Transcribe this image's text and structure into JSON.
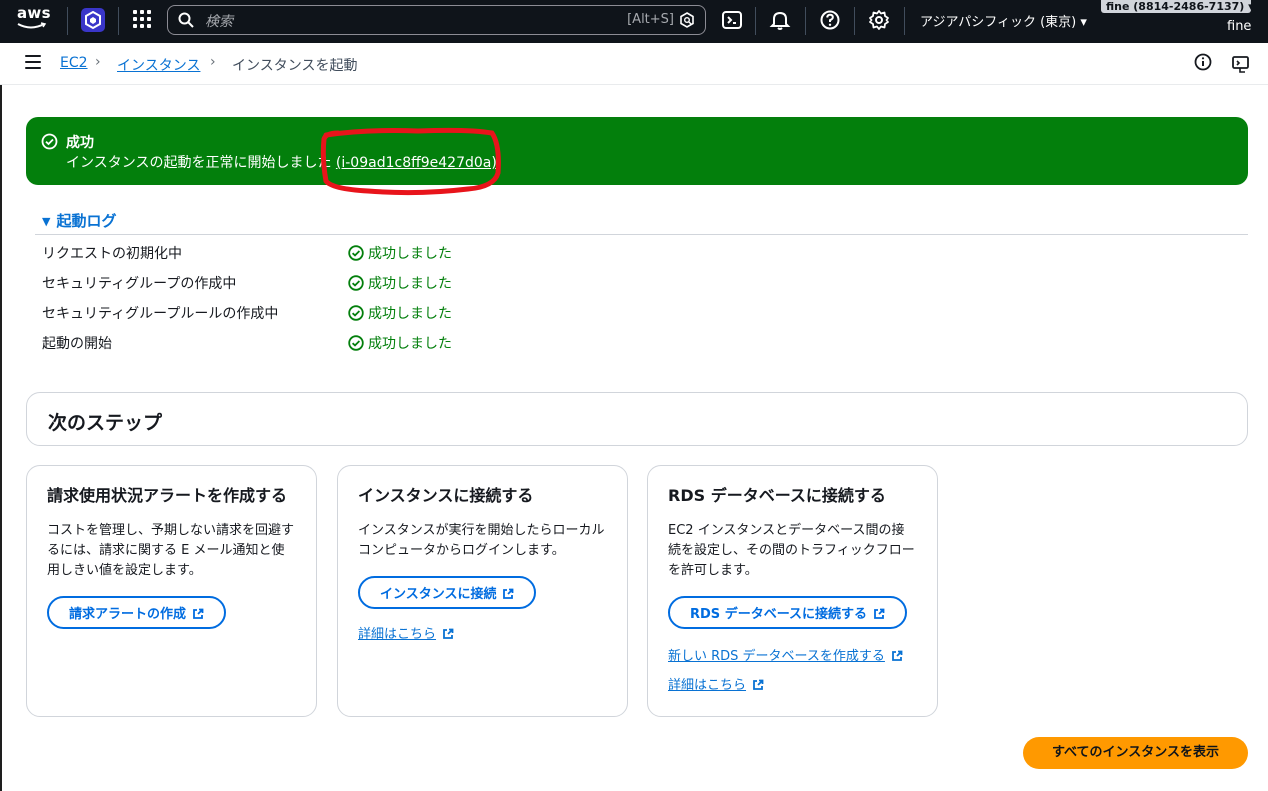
{
  "topnav": {
    "logo_text": "aws",
    "search_placeholder": "検索",
    "search_shortcut": "[Alt+S]",
    "region": "アジアパシフィック (東京) ▾",
    "account": "fine (8814-2486-7137) ▾",
    "user": "fine",
    "icons": [
      "services-icon",
      "grid-icon",
      "search-icon",
      "cloudshell-icon",
      "bell-icon",
      "help-icon",
      "settings-icon"
    ]
  },
  "breadcrumb": {
    "items": [
      "EC2",
      "インスタンス",
      "インスタンスを起動"
    ],
    "separator": "›"
  },
  "flash": {
    "title": "成功",
    "message": "インスタンスの起動を正常に開始しました",
    "instance_id": "(i-09ad1c8ff9e427d0a)",
    "color": "#037f0c"
  },
  "launch_log": {
    "title": "起動ログ",
    "rows": [
      {
        "step": "リクエストの初期化中",
        "status": "成功しました"
      },
      {
        "step": "セキュリティグループの作成中",
        "status": "成功しました"
      },
      {
        "step": "セキュリティグループルールの作成中",
        "status": "成功しました"
      },
      {
        "step": "起動の開始",
        "status": "成功しました"
      }
    ]
  },
  "next_steps": {
    "title": "次のステップ",
    "cards": [
      {
        "title": "請求使用状況アラートを作成する",
        "description": "コストを管理し、予期しない請求を回避するには、請求に関する E メール通知と使用しきい値を設定します。",
        "button": "請求アラートの作成"
      },
      {
        "title": "インスタンスに接続する",
        "description": "インスタンスが実行を開始したらローカルコンピュータからログインします。",
        "button": "インスタンスに接続",
        "link": "詳細はこちら"
      },
      {
        "title": "RDS データベースに接続する",
        "description": "EC2 インスタンスとデータベース間の接続を設定し、その間のトラフィックフローを許可します。",
        "button": "RDS データベースに接続する",
        "link1": "新しい RDS データベースを作成する",
        "link2": "詳細はこちら"
      }
    ]
  },
  "primary_button": "すべてのインスタンスを表示",
  "colors": {
    "nav_bg": "#0f141a",
    "link": "#0972d3",
    "success": "#037f0c",
    "primary": "#ff9900",
    "annotation": "#e8141b"
  }
}
